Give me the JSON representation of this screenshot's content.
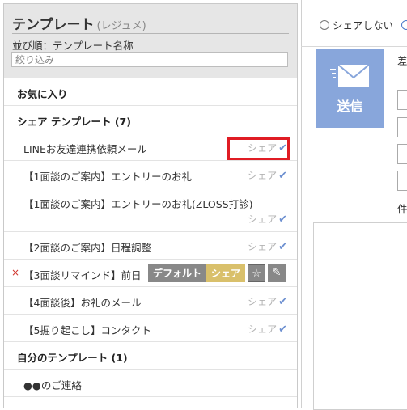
{
  "panel": {
    "title": "テンプレート",
    "title_sub": "(レジュメ)",
    "sort_label": "並び順：テンプレート名称",
    "filter_placeholder": "絞り込み"
  },
  "sections": {
    "favorites": "お気に入り",
    "shared": "シェア テンプレート (7)",
    "mine": "自分のテンプレート (1)"
  },
  "shared_templates": [
    {
      "name": "LINEお友達連携依頼メール",
      "share": "シェア"
    },
    {
      "name": "【1面談のご案内】エントリーのお礼",
      "share": "シェア"
    },
    {
      "name": "【1面談のご案内】エントリーのお礼(ZLOSS打診)",
      "share": "シェア"
    },
    {
      "name": "【2面談のご案内】日程調整",
      "share": "シェア"
    },
    {
      "name": "【3面談リマインド】前日",
      "share": "シェア"
    },
    {
      "name": "【4面談後】お礼のメール",
      "share": "シェア"
    },
    {
      "name": "【5掘り起こし】コンタクト",
      "share": "シェア"
    }
  ],
  "my_templates": [
    {
      "name": "●●のご連絡"
    }
  ],
  "hover_actions": {
    "remove": "×",
    "default_label": "デフォルト",
    "share_label": "シェア",
    "star": "☆",
    "edit": "✎"
  },
  "check_mark": "✔",
  "right": {
    "share_option": "シェアしない",
    "send_label": "送信",
    "side_label_1": "差",
    "side_label_2": "件"
  },
  "colors": {
    "header_bg": "#e6e6e6",
    "send_button": "#88a6db",
    "check": "#6c8fd0",
    "highlight": "#e01c24",
    "share_badge": "#d9c06b"
  }
}
